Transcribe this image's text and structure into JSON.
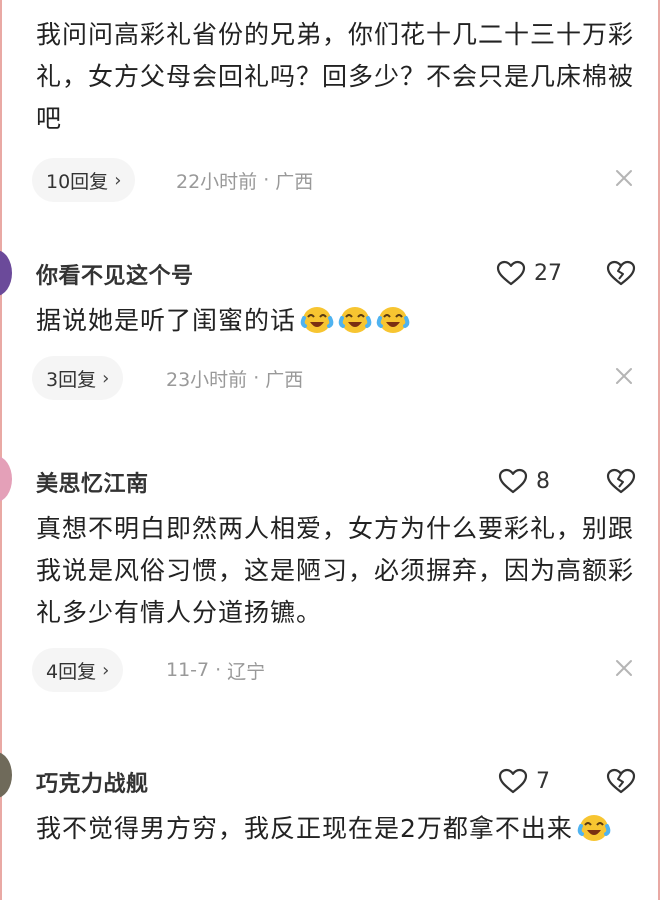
{
  "comments": [
    {
      "author": "",
      "text": "我问问高彩礼省份的兄弟，你们花十几二十三十万彩礼，女方父母会回礼吗？回多少？不会只是几床棉被吧",
      "replies_label": "10回复",
      "time": "22小时前",
      "location": "广西",
      "likes": ""
    },
    {
      "author": "你看不见这个号",
      "text": "据说她是听了闺蜜的话",
      "emoji_count": 3,
      "replies_label": "3回复",
      "time": "23小时前",
      "location": "广西",
      "likes": "27"
    },
    {
      "author": "美思忆江南",
      "text": "真想不明白即然两人相爱，女方为什么要彩礼，别跟我说是风俗习惯，这是陋习，必须摒弃，因为高额彩礼多少有情人分道扬镳。",
      "replies_label": "4回复",
      "time": "11-7",
      "location": "辽宁",
      "likes": "8"
    },
    {
      "author": "巧克力战舰",
      "text": "我不觉得男方穷，我反正现在是2万都拿不出来",
      "emoji_count": 1,
      "likes": "7"
    }
  ],
  "icons": {
    "like": "heart-outline-icon",
    "dislike": "broken-heart-icon",
    "close": "close-x-icon",
    "chevron": "chevron-right-icon",
    "emoji": "laughing-crying-emoji-icon"
  },
  "colors": {
    "frame": "#e9a9a4",
    "pill_bg": "#f5f5f5",
    "meta_text": "#999999"
  }
}
